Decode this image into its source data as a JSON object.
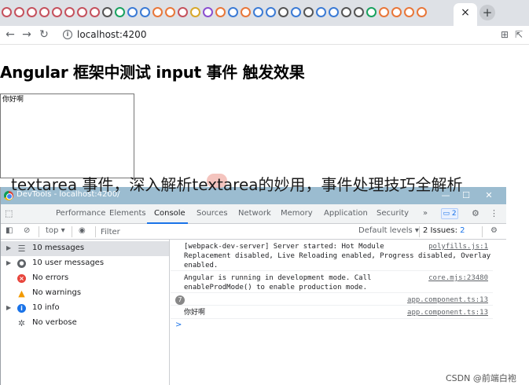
{
  "browser": {
    "url": "localhost:4200",
    "new_tab_label": "+",
    "close_tab_label": "×"
  },
  "page": {
    "heading": "Angular 框架中测试 input 事件 触发效果",
    "textarea_value": "你好啊"
  },
  "overlay": {
    "text": "textarea 事件，深入解析textarea的妙用，事件处理技巧全解析"
  },
  "devtools": {
    "window_title": "DevTools - localhost:4200/",
    "tabs": [
      "Performance",
      "Elements",
      "Console",
      "Sources",
      "Network",
      "Memory",
      "Application",
      "Security"
    ],
    "active_tab": "Console",
    "issues_badge": "2",
    "context": "top",
    "filter_placeholder": "Filter",
    "levels": "Default levels",
    "issues_count": "2 Issues:",
    "issues_count_badge": "2",
    "sidebar": [
      {
        "label": "10 messages",
        "icon": "list-icon",
        "expandable": true,
        "selected": true
      },
      {
        "label": "10 user messages",
        "icon": "user-icon",
        "expandable": true,
        "selected": false
      },
      {
        "label": "No errors",
        "icon": "error-icon",
        "expandable": false,
        "selected": false
      },
      {
        "label": "No warnings",
        "icon": "warning-icon",
        "expandable": false,
        "selected": false
      },
      {
        "label": "10 info",
        "icon": "info-icon",
        "expandable": true,
        "selected": false
      },
      {
        "label": "No verbose",
        "icon": "verbose-icon",
        "expandable": false,
        "selected": false
      }
    ],
    "console": [
      {
        "lines": [
          "[webpack-dev-server] Server started: Hot Module",
          "Replacement disabled, Live Reloading enabled, Progress disabled, Overlay",
          "enabled."
        ],
        "source": "polyfills.js:1"
      },
      {
        "lines": [
          "Angular is running in development mode. Call",
          "enableProdMode() to enable production mode."
        ],
        "source": "core.mjs:23480"
      },
      {
        "lines": [
          ""
        ],
        "source": "app.component.ts:13",
        "count": "7"
      },
      {
        "lines": [
          "你好啊"
        ],
        "source": "app.component.ts:13"
      }
    ],
    "prompt": ">"
  },
  "watermark": "CSDN @前端白袍"
}
